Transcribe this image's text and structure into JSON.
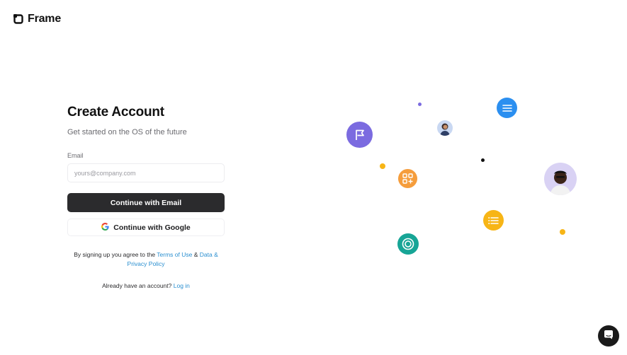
{
  "brand": {
    "name": "Frame"
  },
  "form": {
    "title": "Create Account",
    "subtitle": "Get started on the OS of the future",
    "email_label": "Email",
    "email_placeholder": "yours@company.com",
    "email_value": "",
    "continue_email_label": "Continue with Email",
    "continue_google_label": "Continue with Google",
    "terms_prefix": "By signing up you agree to the",
    "terms_of_use": "Terms of Use",
    "terms_and": "&",
    "privacy_policy": "Data & Privacy Policy",
    "login_prompt": "Already have an account?",
    "login_link": "Log in"
  },
  "illustration": {
    "icons": [
      "flag-icon",
      "avatar-woman",
      "menu-icon",
      "apps-add-icon",
      "avatar-man",
      "list-icon",
      "target-icon"
    ],
    "colors": {
      "purple": "#7b6be0",
      "blue": "#2b8ff0",
      "orange": "#f59d3c",
      "yellow": "#f7b516",
      "teal": "#17a596",
      "dark": "#2b2b2d",
      "link": "#2a8fd0"
    }
  },
  "support": {
    "icon": "chat-icon"
  }
}
